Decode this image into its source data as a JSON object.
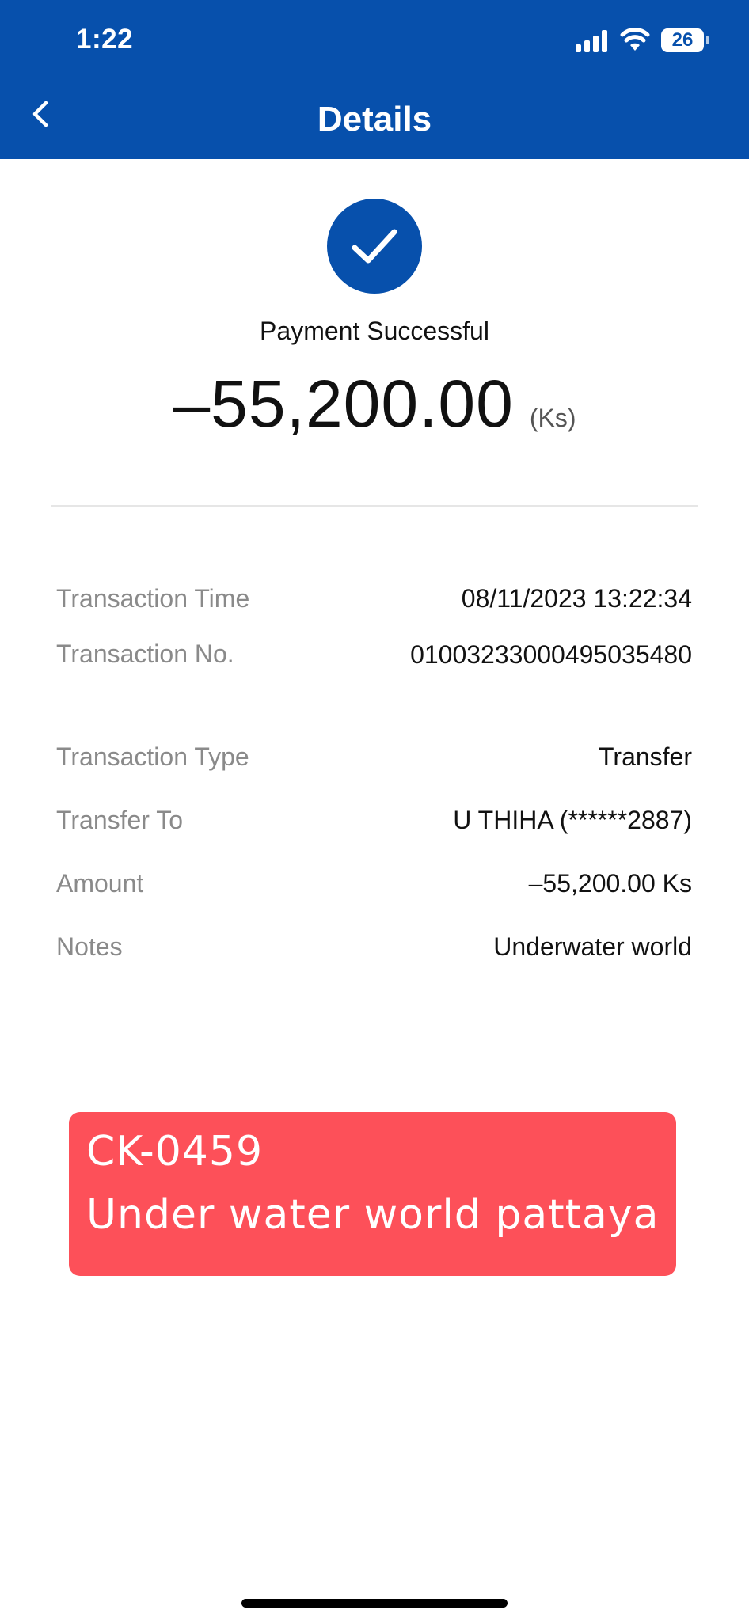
{
  "status_bar": {
    "time": "1:22",
    "battery_level": "26",
    "icons": [
      "signal-icon",
      "wifi-icon",
      "battery-icon"
    ]
  },
  "header": {
    "title": "Details",
    "back_icon": "chevron-left-icon",
    "background_color": "#0750ac"
  },
  "receipt": {
    "status_icon": "check-circle-icon",
    "status": "Payment Successful",
    "amount": "–55,200.00",
    "currency": "(Ks)"
  },
  "details": [
    {
      "label": "Transaction Time",
      "value": "08/11/2023 13:22:34"
    },
    {
      "label": "Transaction No.",
      "value": "01003233000495035480"
    },
    {
      "label": "Transaction Type",
      "value": "Transfer"
    },
    {
      "label": "Transfer To",
      "value": "U THIHA (******2887)"
    },
    {
      "label": "Amount",
      "value": "–55,200.00 Ks"
    },
    {
      "label": "Notes",
      "value": "Underwater world"
    }
  ],
  "overlay": {
    "line1": "CK-0459",
    "line2": "Under water world pattaya",
    "background_color": "#fd5059"
  }
}
